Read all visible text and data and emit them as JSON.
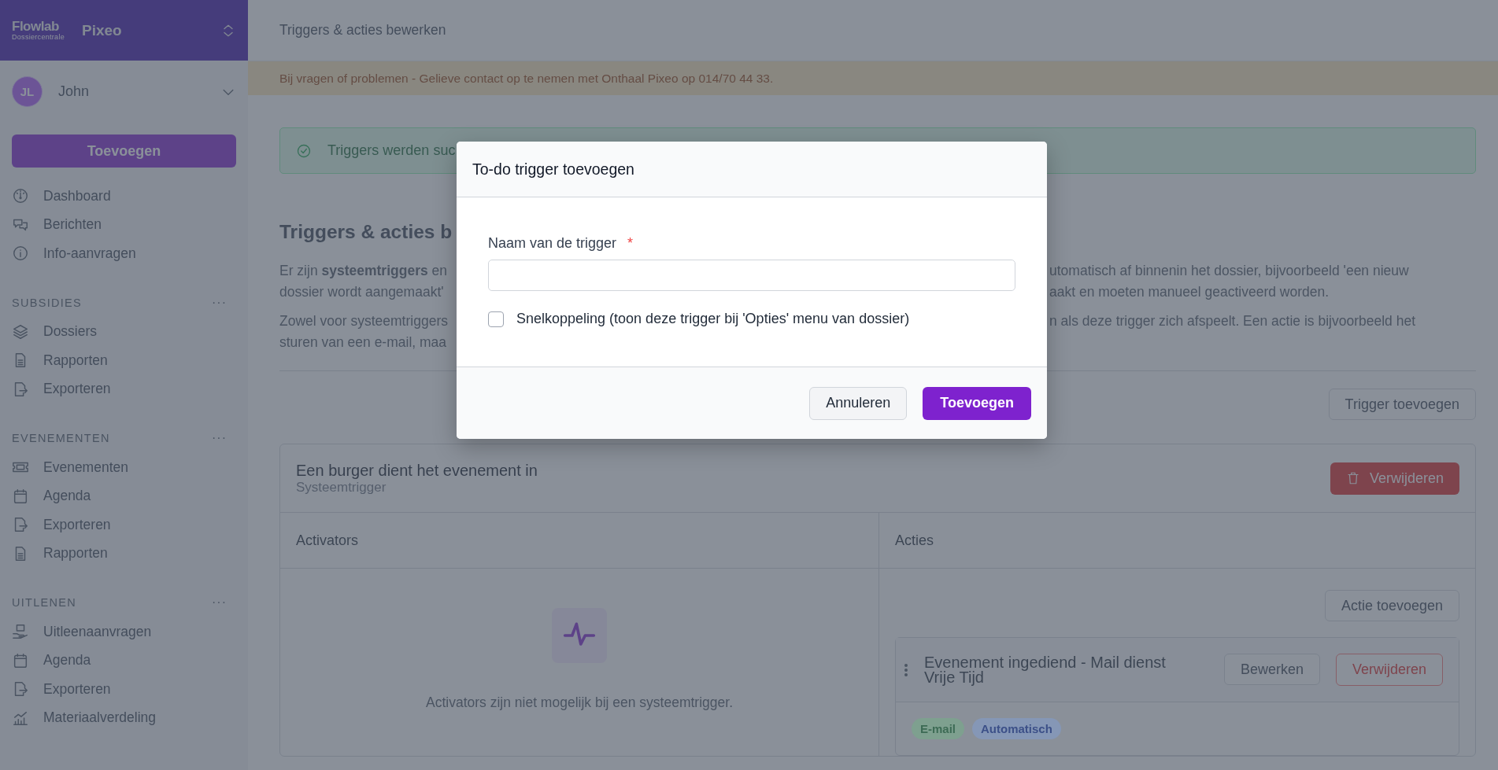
{
  "sidebar": {
    "logo": "Flowlab",
    "logo_sub": "Dossiercentrale",
    "org": "Pixeo",
    "user": {
      "initials": "JL",
      "name": "John"
    },
    "add_button": "Toevoegen",
    "items": [
      {
        "label": "Dashboard"
      },
      {
        "label": "Berichten"
      },
      {
        "label": "Info-aanvragen"
      }
    ],
    "sections": [
      {
        "title": "SUBSIDIES",
        "more": "···",
        "items": [
          {
            "label": "Dossiers"
          },
          {
            "label": "Rapporten"
          },
          {
            "label": "Exporteren"
          }
        ]
      },
      {
        "title": "EVENEMENTEN",
        "more": "···",
        "items": [
          {
            "label": "Evenementen"
          },
          {
            "label": "Agenda"
          },
          {
            "label": "Exporteren"
          },
          {
            "label": "Rapporten"
          }
        ]
      },
      {
        "title": "UITLENEN",
        "more": "···",
        "items": [
          {
            "label": "Uitleenaanvragen"
          },
          {
            "label": "Agenda"
          },
          {
            "label": "Exporteren"
          },
          {
            "label": "Materiaalverdeling"
          }
        ]
      }
    ]
  },
  "header": {
    "title": "Triggers & acties bewerken"
  },
  "notice": "Bij vragen of problemen - Gelieve contact op te nemen met Onthaal Pixeo op 014/70 44 33.",
  "success_alert": "Triggers werden suc",
  "page": {
    "heading": "Triggers & acties b",
    "paragraphs": [
      [
        {
          "left": "Er zijn **systeemtriggers** en",
          "right": "utomatisch af binnenin het dossier, bijvoorbeeld 'een nieuw"
        },
        {
          "left": "dossier wordt aangemaakt'",
          "right": "aakt en moeten manueel geactiveerd worden."
        }
      ],
      [
        {
          "left": "Zowel voor systeemtriggers",
          "right": "n als deze trigger zich afspeelt. Een actie is bijvoorbeeld het"
        },
        {
          "left": "sturen van een e-mail, maa"
        }
      ]
    ],
    "add_trigger_button": "Trigger toevoegen"
  },
  "trigger": {
    "title": "Een burger dient het evenement in",
    "subtitle": "Systeemtrigger",
    "delete_button": "Verwijderen",
    "activators": {
      "title": "Activators",
      "empty_text": "Activators zijn niet mogelijk bij een systeemtrigger."
    },
    "actions": {
      "title": "Acties",
      "add_button": "Actie toevoegen",
      "items": [
        {
          "title": "Evenement ingediend - Mail dienst Vrije Tijd",
          "edit_button": "Bewerken",
          "delete_button": "Verwijderen",
          "tags": [
            {
              "label": "E-mail",
              "color": "#7ea08f"
            },
            {
              "label": "Automatisch",
              "color": "#8597b6"
            }
          ]
        }
      ]
    }
  },
  "modal": {
    "title": "To-do trigger toevoegen",
    "field_label": "Naam van de trigger",
    "required_mark": "*",
    "checkbox": {
      "label": "Snelkoppeling (toon deze trigger bij 'Opties' menu van dossier)",
      "checked": false
    },
    "cancel_button": "Annuleren",
    "submit_button": "Toevoegen"
  }
}
